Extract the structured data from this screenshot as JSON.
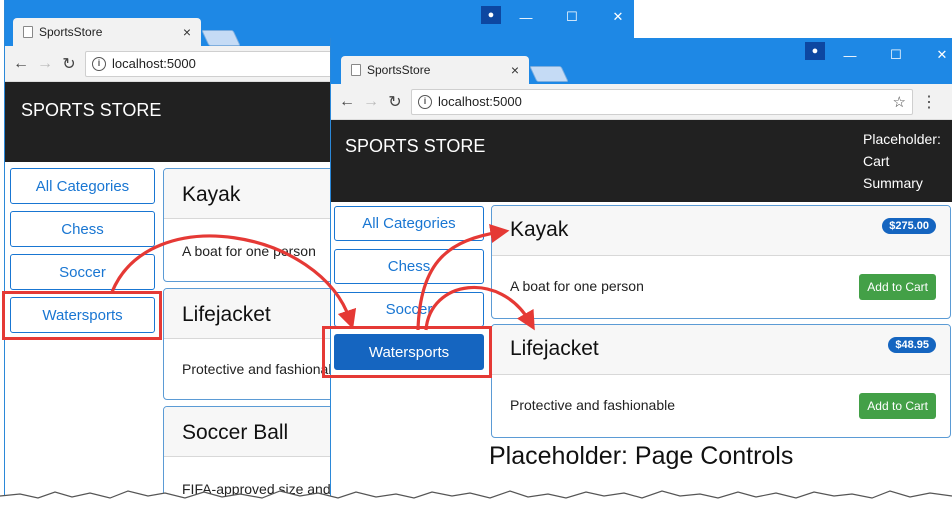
{
  "browser": {
    "tab_title": "SportsStore",
    "tab_close": "×",
    "url": "localhost:5000",
    "user_icon": "person-icon",
    "controls": {
      "minimize": "—",
      "maximize": "☐",
      "close": "✕"
    }
  },
  "store": {
    "brand": "SPORTS STORE",
    "cart_summary": "Placeholder: Cart Summary"
  },
  "categories": [
    "All Categories",
    "Chess",
    "Soccer",
    "Watersports"
  ],
  "back_window": {
    "selected_category": "Watersports",
    "products": [
      {
        "name": "Kayak",
        "description": "A boat for one person"
      },
      {
        "name": "Lifejacket",
        "description": "Protective and fashionable"
      },
      {
        "name": "Soccer Ball",
        "description": "FIFA-approved size and weight"
      }
    ]
  },
  "front_window": {
    "selected_category": "Watersports",
    "products": [
      {
        "name": "Kayak",
        "description": "A boat for one person",
        "price": "$275.00"
      },
      {
        "name": "Lifejacket",
        "description": "Protective and fashionable",
        "price": "$48.95"
      }
    ],
    "add_to_cart_label": "Add to Cart",
    "page_controls": "Placeholder: Page Controls"
  },
  "colors": {
    "titlebar": "#1e88e5",
    "navbar": "#212121",
    "category_border": "#1976d2",
    "active_category": "#1565c0",
    "price_badge": "#1565c0",
    "add_button": "#43a047",
    "annotation": "#e53935"
  }
}
